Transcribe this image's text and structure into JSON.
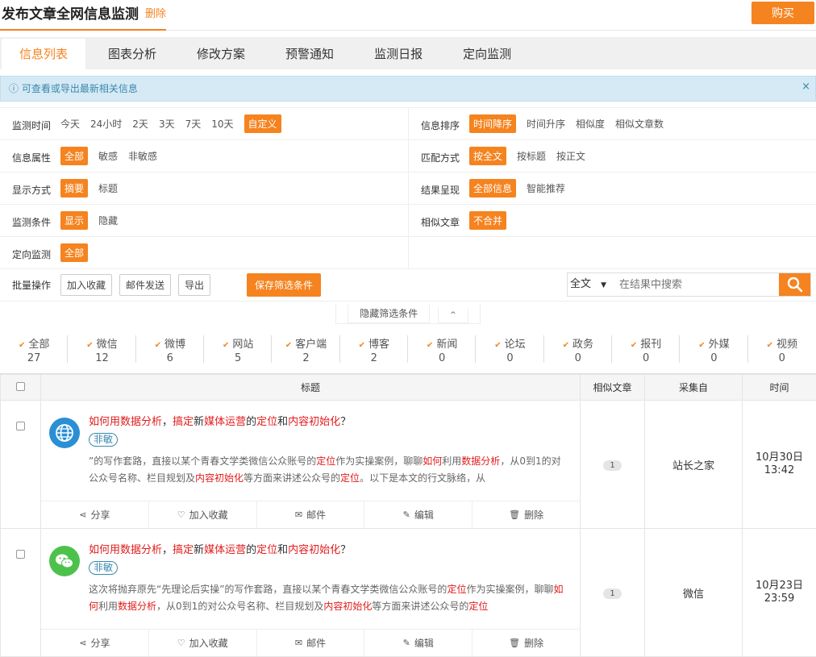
{
  "header": {
    "title": "发布文章全网信息监测",
    "delete_label": "删除",
    "buy_label": "购买"
  },
  "tabs": [
    "信息列表",
    "图表分析",
    "修改方案",
    "预警通知",
    "监测日报",
    "定向监测"
  ],
  "alert": {
    "text": "可查看或导出最新相关信息",
    "close": "×"
  },
  "filters": {
    "time": {
      "label": "监测时间",
      "options": [
        "今天",
        "24小时",
        "2天",
        "3天",
        "7天",
        "10天",
        "自定义"
      ],
      "selected": "自定义"
    },
    "sort": {
      "label": "信息排序",
      "options": [
        "时间降序",
        "时间升序",
        "相似度",
        "相似文章数"
      ],
      "selected": "时间降序"
    },
    "attr": {
      "label": "信息属性",
      "options": [
        "全部",
        "敏感",
        "非敏感"
      ],
      "selected": "全部"
    },
    "match": {
      "label": "匹配方式",
      "options": [
        "按全文",
        "按标题",
        "按正文"
      ],
      "selected": "按全文"
    },
    "display": {
      "label": "显示方式",
      "options": [
        "摘要",
        "标题"
      ],
      "selected": "摘要"
    },
    "result": {
      "label": "结果呈现",
      "options": [
        "全部信息",
        "智能推荐"
      ],
      "selected": "全部信息"
    },
    "cond": {
      "label": "监测条件",
      "options": [
        "显示",
        "隐藏"
      ],
      "selected": "显示"
    },
    "similar": {
      "label": "相似文章",
      "options": [
        "不合并"
      ],
      "selected": "不合并"
    },
    "directed": {
      "label": "定向监测",
      "options": [
        "全部"
      ],
      "selected": "全部"
    }
  },
  "batch": {
    "label": "批量操作",
    "buttons": [
      "加入收藏",
      "邮件发送",
      "导出"
    ],
    "save_label": "保存筛选条件"
  },
  "search": {
    "scope": "全文",
    "placeholder": "在结果中搜索"
  },
  "hide_filters": "隐藏筛选条件",
  "counts": [
    {
      "label": "全部",
      "num": "27"
    },
    {
      "label": "微信",
      "num": "12"
    },
    {
      "label": "微博",
      "num": "6"
    },
    {
      "label": "网站",
      "num": "5"
    },
    {
      "label": "客户端",
      "num": "2"
    },
    {
      "label": "博客",
      "num": "2"
    },
    {
      "label": "新闻",
      "num": "0"
    },
    {
      "label": "论坛",
      "num": "0"
    },
    {
      "label": "政务",
      "num": "0"
    },
    {
      "label": "报刊",
      "num": "0"
    },
    {
      "label": "外媒",
      "num": "0"
    },
    {
      "label": "视频",
      "num": "0"
    }
  ],
  "table": {
    "headers": [
      "标题",
      "相似文章",
      "采集自",
      "时间"
    ]
  },
  "actions": [
    "分享",
    "加入收藏",
    "邮件",
    "编辑",
    "删除"
  ],
  "articles": [
    {
      "title_parts": [
        {
          "t": "如何用数据分析",
          "h": true
        },
        {
          "t": "，",
          "h": false
        },
        {
          "t": "搞定",
          "h": true
        },
        {
          "t": "新",
          "h": false
        },
        {
          "t": "媒体运营",
          "h": true
        },
        {
          "t": "的",
          "h": false
        },
        {
          "t": "定位",
          "h": true
        },
        {
          "t": "和",
          "h": false
        },
        {
          "t": "内容初始化",
          "h": true
        },
        {
          "t": "？",
          "h": false
        }
      ],
      "tag": "非敏",
      "snippet_parts": [
        {
          "t": "”的写作套路，直接以某个青春文学类微信公众账号的",
          "h": false
        },
        {
          "t": "定位",
          "h": true
        },
        {
          "t": "作为实操案例，聊聊",
          "h": false
        },
        {
          "t": "如何",
          "h": true
        },
        {
          "t": "利用",
          "h": false
        },
        {
          "t": "数据分析",
          "h": true
        },
        {
          "t": "，从0到1的对公众号名称、栏目规划及",
          "h": false
        },
        {
          "t": "内容初始化",
          "h": true
        },
        {
          "t": "等方面来讲述公众号的",
          "h": false
        },
        {
          "t": "定位",
          "h": true
        },
        {
          "t": "。以下是本文的行文脉络，从",
          "h": false
        }
      ],
      "similar": "1",
      "source": "站长之家",
      "date": "10月30日",
      "time": "13:42",
      "icon": "globe-icon",
      "icon_color": "#2b8fd6"
    },
    {
      "title_parts": [
        {
          "t": "如何用数据分析",
          "h": true
        },
        {
          "t": "，",
          "h": false
        },
        {
          "t": "搞定",
          "h": true
        },
        {
          "t": "新",
          "h": false
        },
        {
          "t": "媒体运营",
          "h": true
        },
        {
          "t": "的",
          "h": false
        },
        {
          "t": "定位",
          "h": true
        },
        {
          "t": "和",
          "h": false
        },
        {
          "t": "内容初始化",
          "h": true
        },
        {
          "t": "？",
          "h": false
        }
      ],
      "tag": "非敏",
      "snippet_parts": [
        {
          "t": "这次将抛弃原先“先理论后实操”的写作套路，直接以某个青春文学类微信公众账号的",
          "h": false
        },
        {
          "t": "定位",
          "h": true
        },
        {
          "t": "作为实操案例，聊聊",
          "h": false
        },
        {
          "t": "如何",
          "h": true
        },
        {
          "t": "利用",
          "h": false
        },
        {
          "t": "数据分析",
          "h": true
        },
        {
          "t": "，从0到1的对公众号名称、栏目规划及",
          "h": false
        },
        {
          "t": "内容初始化",
          "h": true
        },
        {
          "t": "等方面来讲述公众号的",
          "h": false
        },
        {
          "t": "定位",
          "h": true
        }
      ],
      "similar": "1",
      "source": "微信",
      "date": "10月23日",
      "time": "23:59",
      "icon": "wechat-icon",
      "icon_color": "#4cc24c"
    }
  ],
  "colors": {
    "accent": "#f5831f",
    "highlight": "#e21b1b",
    "info": "#3a87ad"
  }
}
